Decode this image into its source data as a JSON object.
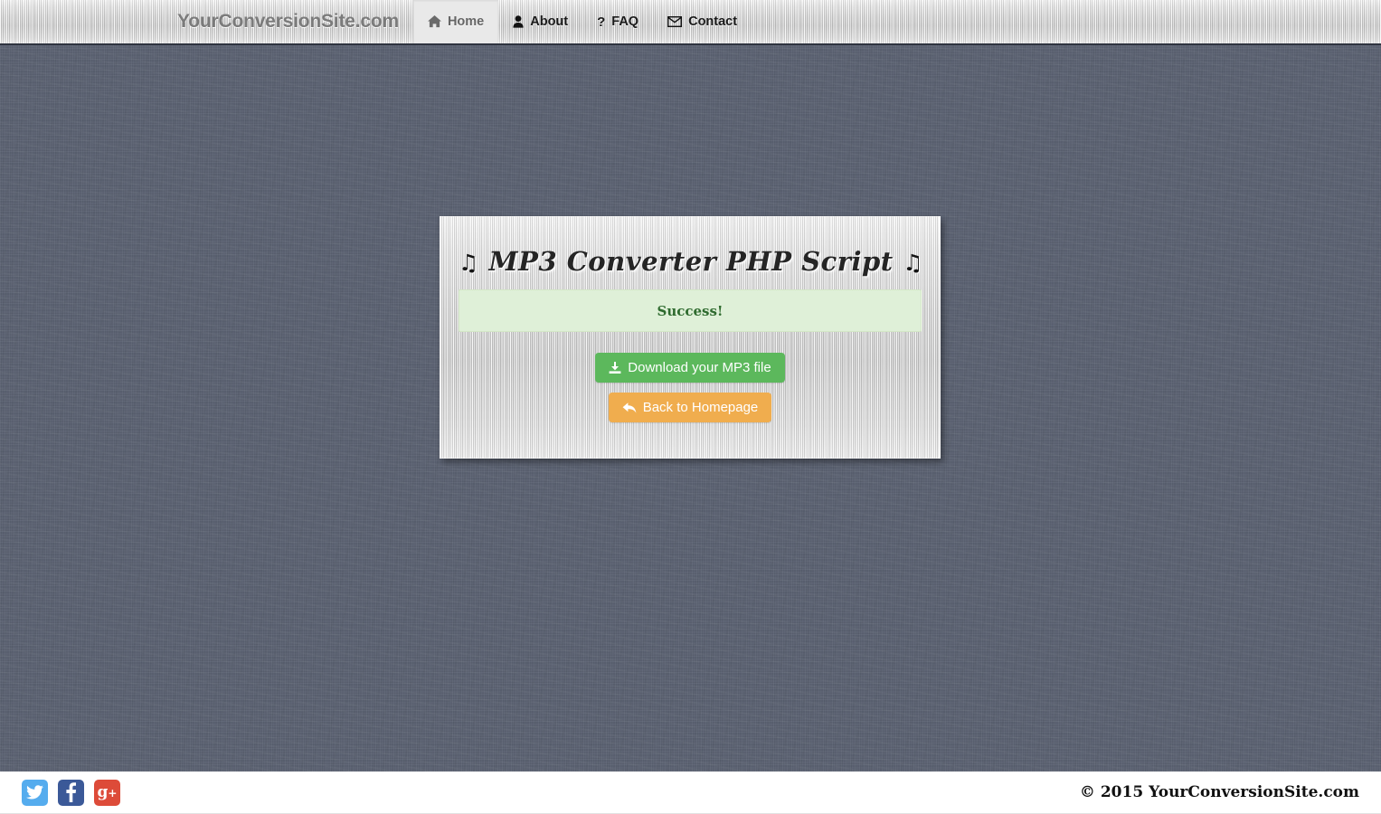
{
  "navbar": {
    "brand": "YourConversionSite.com",
    "items": [
      {
        "label": "Home",
        "icon": "home-icon",
        "active": true
      },
      {
        "label": "About",
        "icon": "user-icon",
        "active": false
      },
      {
        "label": "FAQ",
        "icon": "question-icon",
        "active": false
      },
      {
        "label": "Contact",
        "icon": "envelope-icon",
        "active": false
      }
    ]
  },
  "panel": {
    "title": "MP3 Converter PHP Script",
    "title_note_left": "♫",
    "title_note_right": "♫",
    "alert": {
      "text": "Success!",
      "bg_color": "#dff0d8",
      "text_color": "#2f6b2f"
    },
    "buttons": [
      {
        "label": "Download your MP3 file",
        "icon": "download-icon",
        "style": "btn-success",
        "color": "#5cb85c"
      },
      {
        "label": "Back to Homepage",
        "icon": "reply-arrow-icon",
        "style": "btn-warning",
        "color": "#f0ad4e"
      }
    ]
  },
  "footer": {
    "social": [
      {
        "name": "twitter",
        "color": "#55acee"
      },
      {
        "name": "facebook",
        "color": "#3b5998"
      },
      {
        "name": "googleplus",
        "color": "#dd4b39"
      }
    ],
    "copyright": "© 2015 YourConversionSite.com"
  }
}
